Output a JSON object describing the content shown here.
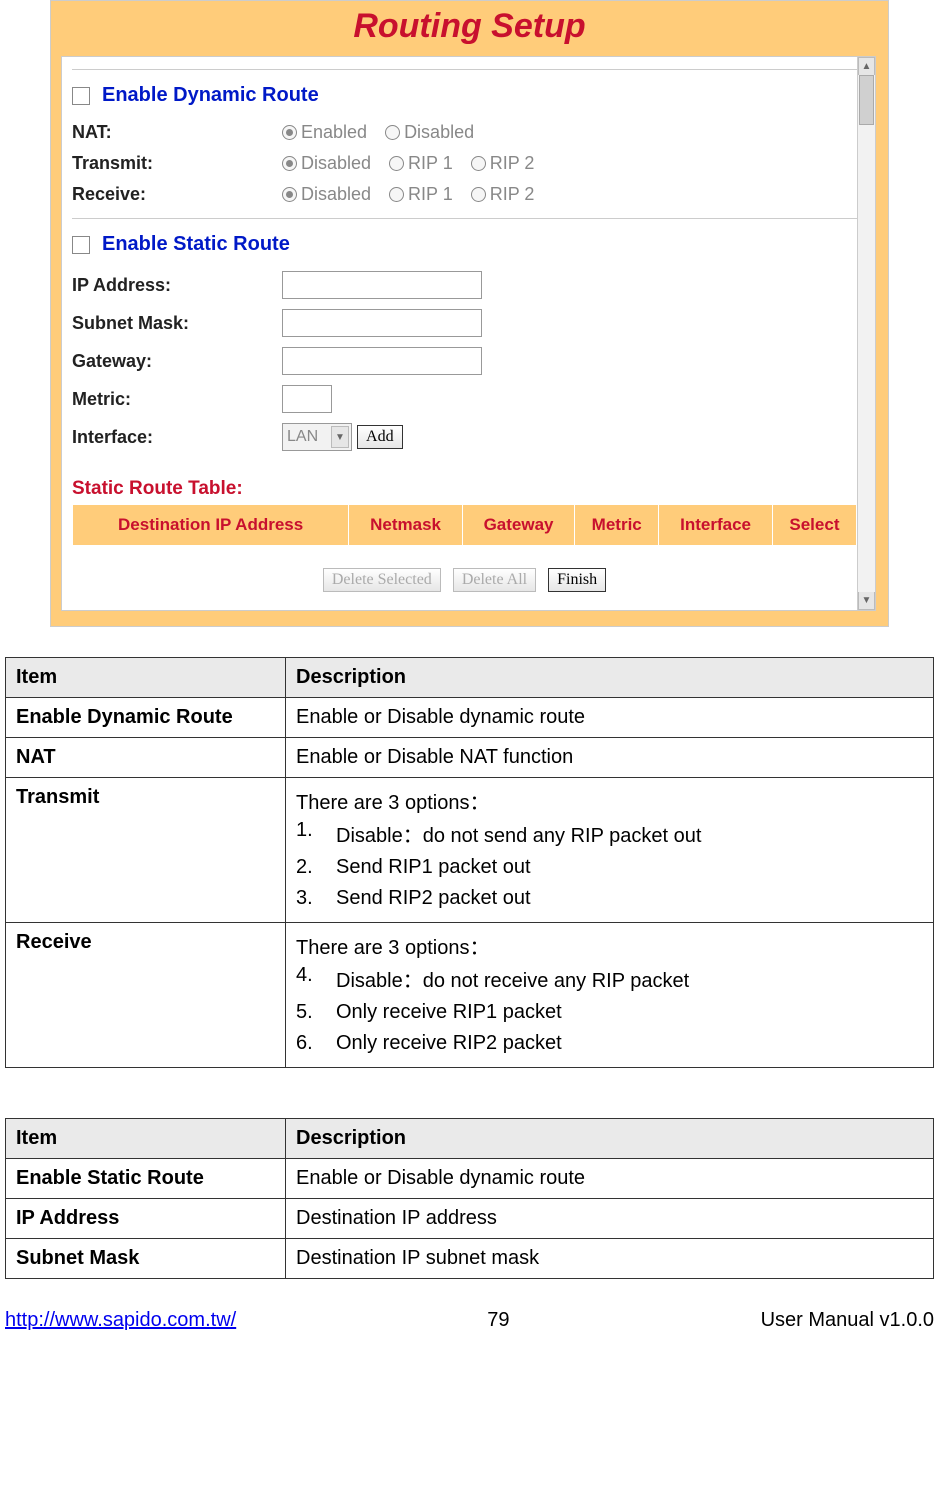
{
  "screenshot": {
    "title": "Routing Setup",
    "dynamic": {
      "checkbox_label": "Enable Dynamic Route",
      "rows": {
        "nat": {
          "label": "NAT:",
          "options": [
            "Enabled",
            "Disabled"
          ],
          "selected": 0
        },
        "transmit": {
          "label": "Transmit:",
          "options": [
            "Disabled",
            "RIP 1",
            "RIP 2"
          ],
          "selected": 0
        },
        "receive": {
          "label": "Receive:",
          "options": [
            "Disabled",
            "RIP 1",
            "RIP 2"
          ],
          "selected": 0
        }
      }
    },
    "static": {
      "checkbox_label": "Enable Static Route",
      "rows": {
        "ip": {
          "label": "IP Address:"
        },
        "mask": {
          "label": "Subnet Mask:"
        },
        "gateway": {
          "label": "Gateway:"
        },
        "metric": {
          "label": "Metric:"
        },
        "interface": {
          "label": "Interface:",
          "select_value": "LAN",
          "add_label": "Add"
        }
      }
    },
    "table": {
      "title": "Static Route Table:",
      "headers": [
        "Destination IP Address",
        "Netmask",
        "Gateway",
        "Metric",
        "Interface",
        "Select"
      ]
    },
    "buttons": {
      "delete_selected": "Delete Selected",
      "delete_all": "Delete All",
      "finish": "Finish"
    }
  },
  "desc_table_1": {
    "header_item": "Item",
    "header_desc": "Description",
    "rows": [
      {
        "item": "Enable Dynamic Route",
        "desc_plain": "Enable or Disable dynamic route"
      },
      {
        "item": "NAT",
        "desc_plain": "Enable or Disable NAT function"
      },
      {
        "item": "Transmit",
        "desc_intro": "There are 3 options：",
        "desc_list": [
          {
            "n": "1.",
            "t": "Disable：do not send any RIP packet out"
          },
          {
            "n": "2.",
            "t": "Send RIP1 packet out"
          },
          {
            "n": "3.",
            "t": "Send RIP2 packet out"
          }
        ]
      },
      {
        "item": "Receive",
        "desc_intro": "There are 3 options：",
        "desc_list": [
          {
            "n": "4.",
            "t": "Disable：do not receive any RIP packet"
          },
          {
            "n": "5.",
            "t": "Only receive RIP1 packet"
          },
          {
            "n": "6.",
            "t": "Only receive RIP2 packet"
          }
        ]
      }
    ]
  },
  "desc_table_2": {
    "header_item": "Item",
    "header_desc": "Description",
    "rows": [
      {
        "item": "Enable Static Route",
        "desc_plain": "Enable or Disable dynamic route"
      },
      {
        "item": "IP Address",
        "desc_plain": "Destination IP address"
      },
      {
        "item": "Subnet Mask",
        "desc_plain": "Destination IP subnet mask"
      }
    ]
  },
  "footer": {
    "url": "http://www.sapido.com.tw/",
    "page": "79",
    "version": "User Manual v1.0.0"
  }
}
